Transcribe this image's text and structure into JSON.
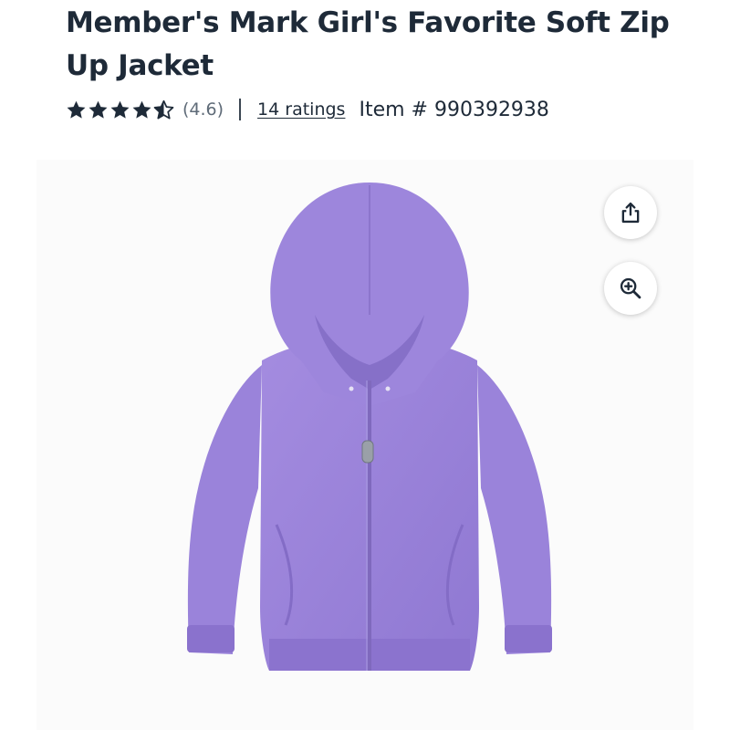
{
  "product": {
    "title": "Member's Mark Girl's Favorite Soft Zip Up Jacket",
    "rating_value": "(4.6)",
    "rating_stars": 4.6,
    "ratings_link": "14 ratings",
    "item_number": "Item # 990392938"
  },
  "actions": {
    "share_icon": "share-icon",
    "zoom_icon": "zoom-in-icon"
  },
  "image": {
    "subject": "jacket",
    "color": "#9b83d9"
  },
  "colors": {
    "text": "#1e2a38",
    "muted": "#5f6b78",
    "star": "#1e2a38"
  }
}
